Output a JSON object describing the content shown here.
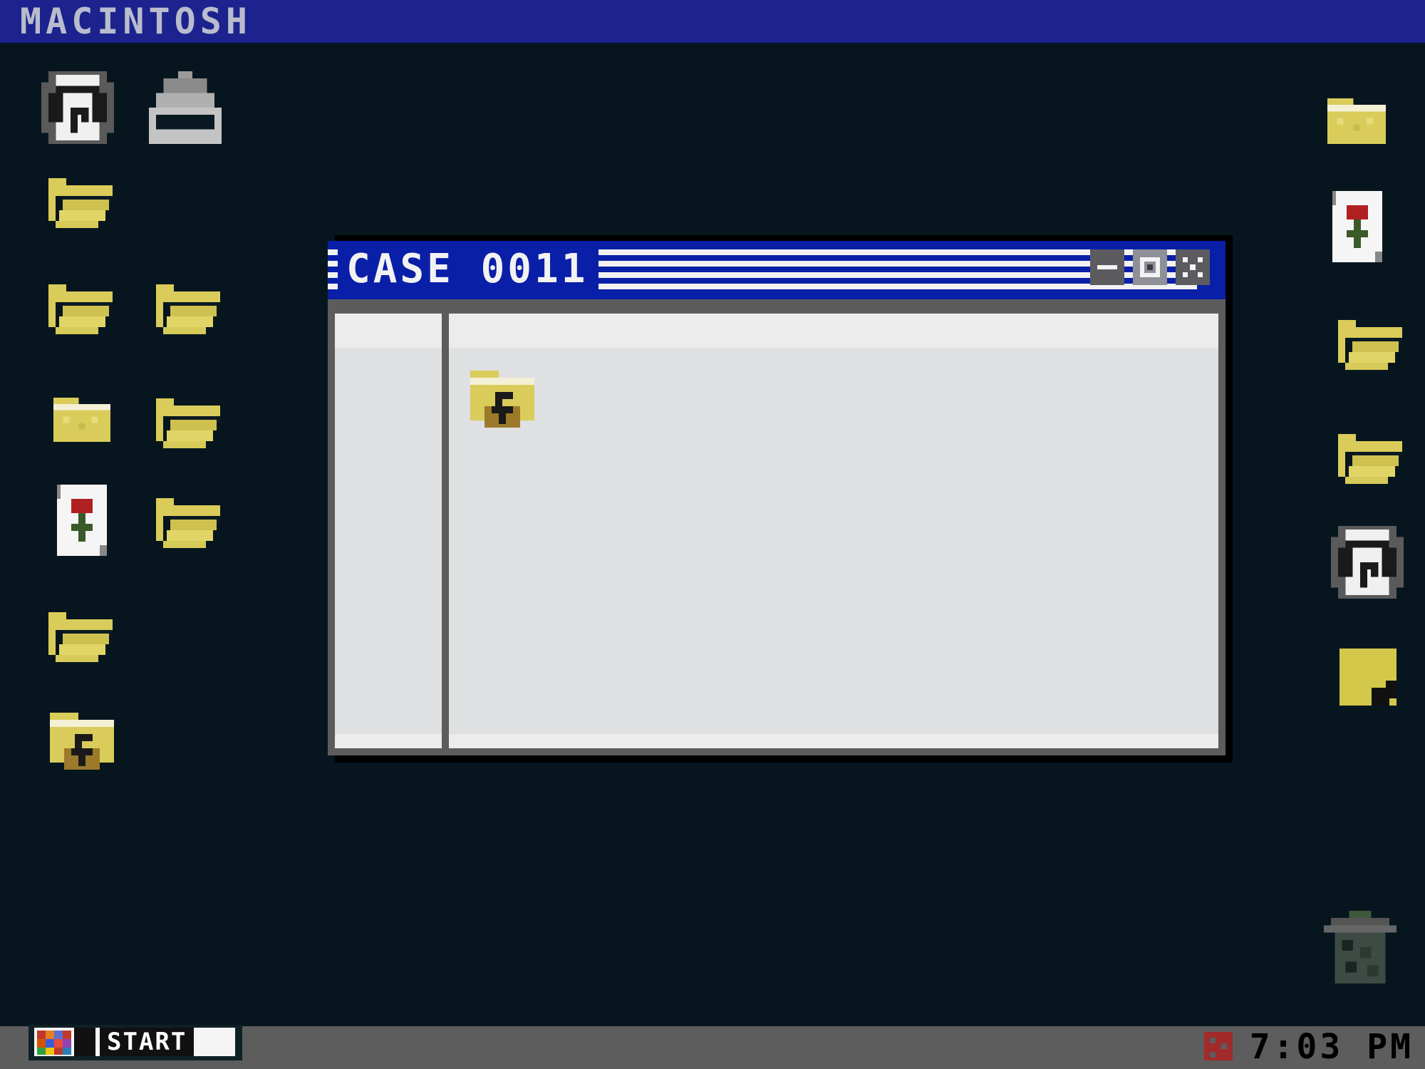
{
  "menubar": {
    "title": "MACINTOSH"
  },
  "window": {
    "title": "CASE 0011",
    "buttons": {
      "minimize": "minimize",
      "maximize": "maximize",
      "close": "close"
    },
    "content_items": [
      {
        "icon": "locked-folder-icon"
      }
    ]
  },
  "desktop": {
    "left_icons": [
      "hard-drive-icon",
      "printer-icon",
      "open-folder-icon",
      "open-folder-icon",
      "open-folder-icon",
      "closed-folder-icon",
      "open-folder-icon",
      "document-icon",
      "open-folder-icon",
      "open-folder-icon",
      "locked-folder-icon"
    ],
    "right_icons": [
      "closed-folder-icon",
      "document-icon",
      "open-folder-icon",
      "open-folder-icon",
      "hard-drive-icon",
      "note-icon",
      "trash-icon"
    ]
  },
  "taskbar": {
    "start_label": "START",
    "clock": "7:03 PM"
  },
  "colors": {
    "desktop": "#07161e",
    "menubar": "#1c238e",
    "titlebar": "#0a1fa8",
    "folder": "#d9cc5a",
    "taskbar": "#5d5d5d"
  }
}
